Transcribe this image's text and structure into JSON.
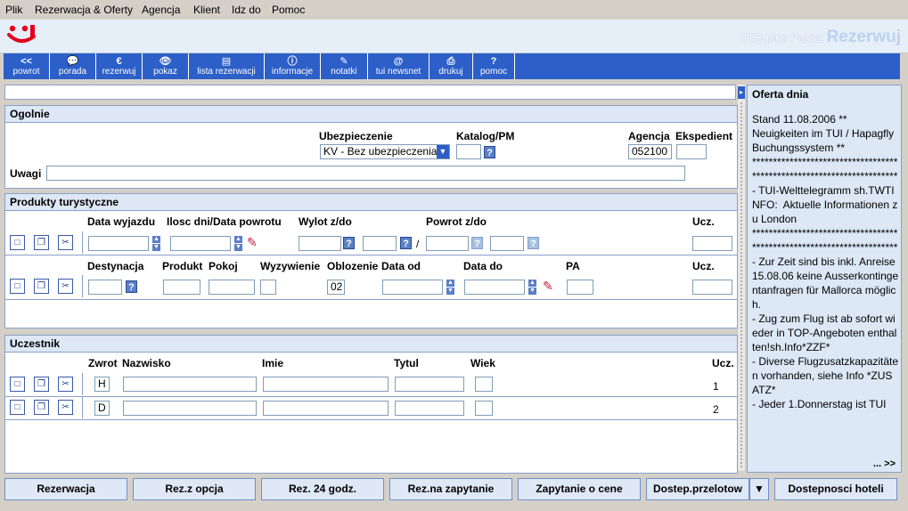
{
  "menu": [
    "Plik",
    "Rezerwacja & Oferty",
    "Agencja",
    "Klient",
    "Idz do",
    "Pomoc"
  ],
  "brand": {
    "product": "IRIS.plus Pakiet",
    "mode": "Rezerwuj"
  },
  "toolbar": [
    {
      "icon": "<<",
      "label": "powrot"
    },
    {
      "icon": "💬",
      "label": "porada"
    },
    {
      "icon": "€",
      "label": "rezerwuj"
    },
    {
      "icon": "👁",
      "label": "pokaz"
    },
    {
      "icon": "▤",
      "label": "lista rezerwacji"
    },
    {
      "icon": "ⓘ",
      "label": "informacje"
    },
    {
      "icon": "✎",
      "label": "notatki"
    },
    {
      "icon": "@",
      "label": "tui newsnet"
    },
    {
      "icon": "⎙",
      "label": "drukuj"
    },
    {
      "icon": "?",
      "label": "pomoc"
    }
  ],
  "general": {
    "title": "Ogolnie",
    "insurance_label": "Ubezpieczenie",
    "insurance_value": "KV - Bez ubezpieczenia",
    "catalog_label": "Katalog/PM",
    "agency_label": "Agencja",
    "agency_value": "052100",
    "clerk_label": "Ekspedient",
    "notes_label": "Uwagi"
  },
  "products": {
    "title": "Produkty turystyczne",
    "row1": {
      "departure_label": "Data wyjazdu",
      "days_label": "Ilosc dni/Data powrotu",
      "flight_out_label": "Wylot z/do",
      "flight_back_label": "Powrot z/do",
      "slash": "/",
      "ucz_label": "Ucz."
    },
    "row2": {
      "destination_label": "Destynacja",
      "product_label": "Produkt",
      "room_label": "Pokoj",
      "board_label": "Wyzywienie",
      "occupancy_label": "Oblozenie",
      "occupancy_value": "02",
      "date_from_label": "Data od",
      "date_to_label": "Data do",
      "pa_label": "PA",
      "ucz_label": "Ucz."
    }
  },
  "participants": {
    "title": "Uczestnik",
    "col_salutation": "Zwrot",
    "col_surname": "Nazwisko",
    "col_firstname": "Imie",
    "col_title": "Tytul",
    "col_age": "Wiek",
    "col_ucz": "Ucz.",
    "rows": [
      {
        "salutation": "H",
        "number": "1"
      },
      {
        "salutation": "D",
        "number": "2"
      }
    ]
  },
  "offer": {
    "title": "Oferta dnia",
    "text": "Stand 11.08.2006 **\nNeuigkeiten im TUI / Hapagfly Buchungssystem **\n**********************************************************************\n- TUI-Welttelegramm sh.TWTINFO:  Aktuelle Informationen zu London\n**********************************************************************\n- Zur Zeit sind bis inkl. Anreise 15.08.06 keine Ausserkontingentanfragen für Mallorca möglich.\n- Zug zum Flug ist ab sofort wieder in TOP-Angeboten enthalten!sh.Info*ZZF*\n- Diverse Flugzusatzkapazitäten vorhanden, siehe Info *ZUSATZ*\n- Jeder 1.Donnerstag ist TUI",
    "more": "... >>"
  },
  "buttons": [
    "Rezerwacja",
    "Rez.z opcja",
    "Rez. 24 godz.",
    "Rez.na zapytanie",
    "Zapytanie o cene",
    "Dostep.przelotow",
    "Dostepnosci hoteli"
  ],
  "colors": {
    "toolbar": "#2c5fc8",
    "panel_header": "#dde7f6",
    "accent": "#5b7fc7",
    "logo": "#e2001a"
  }
}
